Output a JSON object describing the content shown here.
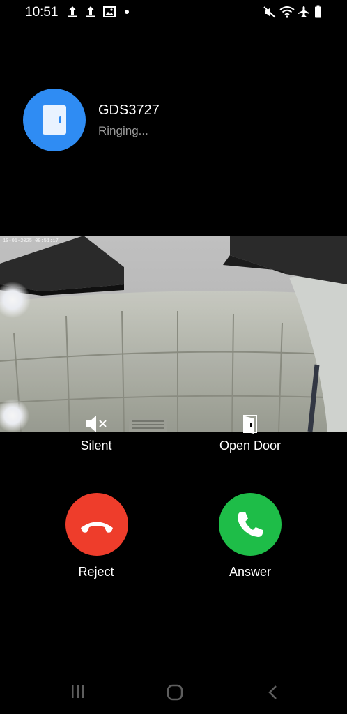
{
  "status_bar": {
    "time": "10:51",
    "left_icons": [
      "upload-icon",
      "upload-icon",
      "image-icon",
      "dot-icon"
    ],
    "right_icons": [
      "mute-icon",
      "wifi-icon",
      "airplane-icon",
      "battery-icon"
    ]
  },
  "caller": {
    "name": "GDS3727",
    "status": "Ringing...",
    "avatar_icon": "door-icon",
    "avatar_color": "#2f8cf3"
  },
  "video": {
    "timestamp": "10-01-2025 09:51:17"
  },
  "actions": {
    "silent_label": "Silent",
    "open_door_label": "Open Door",
    "reject_label": "Reject",
    "answer_label": "Answer"
  },
  "colors": {
    "reject": "#ee3d2b",
    "answer": "#1ebd48",
    "background": "#000000"
  },
  "nav_bar": {
    "icons": [
      "recents-icon",
      "home-icon",
      "back-icon"
    ]
  }
}
